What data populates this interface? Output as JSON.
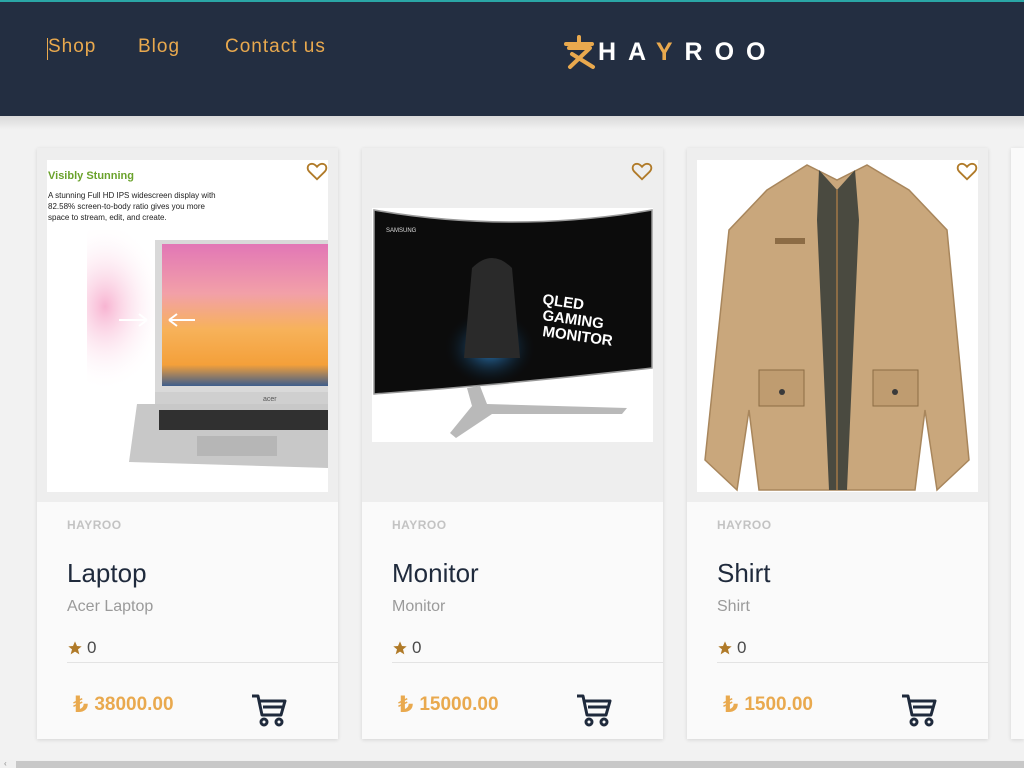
{
  "nav": {
    "links": [
      "Shop",
      "Blog",
      "Contact us"
    ],
    "logo_text_1": "HA",
    "logo_text_accent": "Y",
    "logo_text_2": "ROO"
  },
  "products": [
    {
      "brand": "HAYROO",
      "name": "Laptop",
      "description": "Acer Laptop",
      "rating": "0",
      "currency": "₺",
      "price": "38000.00",
      "image_caption_title": "Visibly Stunning",
      "image_caption_text": "A stunning Full HD IPS widescreen display with 82.58% screen-to-body ratio gives you more space to stream, edit, and create.",
      "image_logo": "acer"
    },
    {
      "brand": "HAYROO",
      "name": "Monitor",
      "description": "Monitor",
      "rating": "0",
      "currency": "₺",
      "price": "15000.00",
      "image_logo": "SAMSUNG",
      "image_text": "QLED GAMING MONITOR"
    },
    {
      "brand": "HAYROO",
      "name": "Shirt",
      "description": "Shirt",
      "rating": "0",
      "currency": "₺",
      "price": "1500.00"
    }
  ],
  "colors": {
    "navbar": "#232e41",
    "accent": "#e9a94e",
    "title": "#1f2a3c"
  }
}
